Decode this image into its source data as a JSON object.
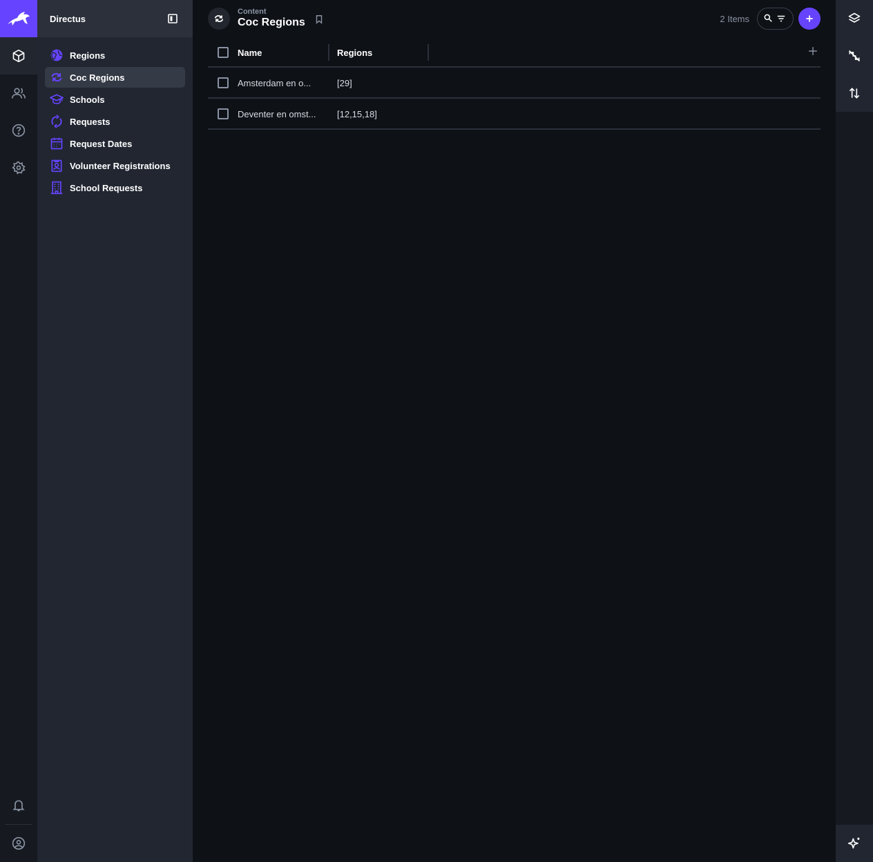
{
  "project": {
    "name": "Directus"
  },
  "colors": {
    "accent": "#6644ff",
    "muted": "#8a93a3"
  },
  "module_bar": {
    "items": [
      {
        "name": "content-module",
        "icon": "cube-icon"
      },
      {
        "name": "users-module",
        "icon": "users-icon"
      },
      {
        "name": "help-module",
        "icon": "help-icon"
      },
      {
        "name": "settings-module",
        "icon": "gear-icon"
      }
    ],
    "bottom": [
      {
        "name": "notifications",
        "icon": "bell-icon"
      },
      {
        "name": "user-profile",
        "icon": "account-icon"
      }
    ]
  },
  "navigation": {
    "items": [
      {
        "label": "Regions",
        "icon": "globe-icon"
      },
      {
        "label": "Coc Regions",
        "icon": "sync-icon",
        "active": true
      },
      {
        "label": "Schools",
        "icon": "school-icon"
      },
      {
        "label": "Requests",
        "icon": "refresh-icon"
      },
      {
        "label": "Request Dates",
        "icon": "calendar-icon"
      },
      {
        "label": "Volunteer Registrations",
        "icon": "badge-icon"
      },
      {
        "label": "School Requests",
        "icon": "building-icon"
      }
    ]
  },
  "header": {
    "breadcrumb": "Content",
    "title": "Coc Regions",
    "items_count": "2 Items"
  },
  "table": {
    "columns": [
      "Name",
      "Regions"
    ],
    "rows": [
      {
        "name": "Amsterdam en o...",
        "regions": "[29]"
      },
      {
        "name": "Deventer en omst...",
        "regions": "[12,15,18]"
      }
    ]
  }
}
